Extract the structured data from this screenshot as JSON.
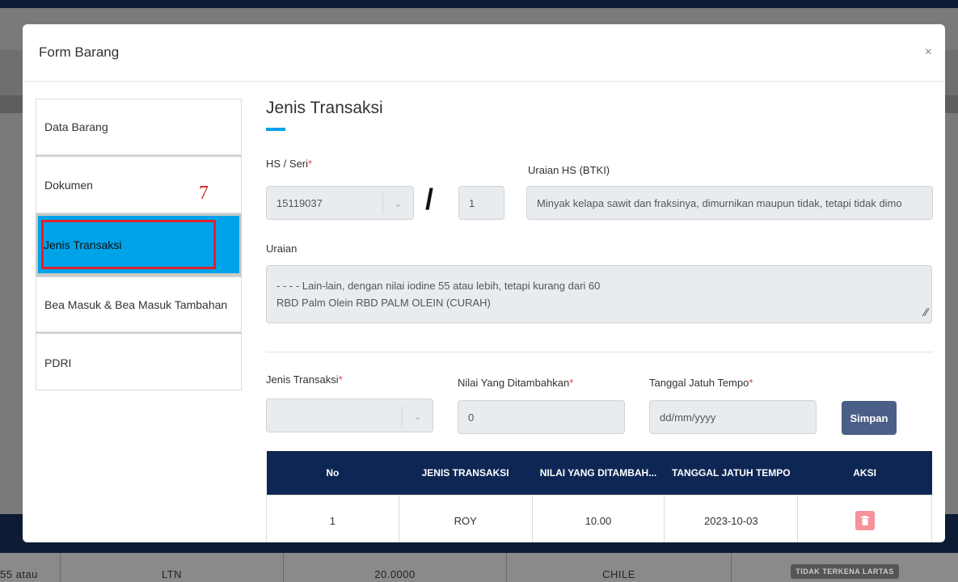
{
  "background": {
    "row_cells": [
      "55 atau",
      "LTN",
      "20.0000",
      "CHILE"
    ],
    "badge": "TIDAK TERKENA LARTAS"
  },
  "modal": {
    "title": "Form Barang",
    "close": "×"
  },
  "sidebar": {
    "items": [
      {
        "label": "Data Barang"
      },
      {
        "label": "Dokumen"
      },
      {
        "label": "Jenis Transaksi"
      },
      {
        "label": "Bea Masuk & Bea Masuk Tambahan"
      },
      {
        "label": "PDRI"
      }
    ],
    "annotation": "7"
  },
  "section": {
    "title": "Jenis Transaksi",
    "accent": "#00a2e8"
  },
  "hs": {
    "label": "HS / Seri",
    "hs_value": "15119037",
    "seri_value": "1",
    "slash": "/",
    "uraian_hs_label": "Uraian HS (BTKI)",
    "uraian_hs_value": "Minyak kelapa sawit dan fraksinya, dimurnikan maupun tidak, tetapi tidak dimo"
  },
  "uraian": {
    "label": "Uraian",
    "line1": "- - - - Lain-lain, dengan nilai iodine 55 atau lebih, tetapi kurang dari 60",
    "line2": "RBD Palm Olein RBD PALM OLEIN (CURAH)"
  },
  "form": {
    "jenis_label": "Jenis Transaksi",
    "jenis_value": "",
    "nilai_label": "Nilai Yang Ditambahkan",
    "nilai_value": "0",
    "tanggal_label": "Tanggal Jatuh Tempo",
    "tanggal_placeholder": "dd/mm/yyyy",
    "save_label": "Simpan",
    "required_mark": "*"
  },
  "table": {
    "headers": [
      "No",
      "JENIS TRANSAKSI",
      "NILAI YANG DITAMBAH...",
      "TANGGAL JATUH TEMPO",
      "AKSI"
    ],
    "rows": [
      {
        "no": "1",
        "jenis": "ROY",
        "nilai": "10.00",
        "tanggal": "2023-10-03"
      }
    ],
    "header_color": "#0e2654",
    "delete_color": "#f7929a"
  }
}
